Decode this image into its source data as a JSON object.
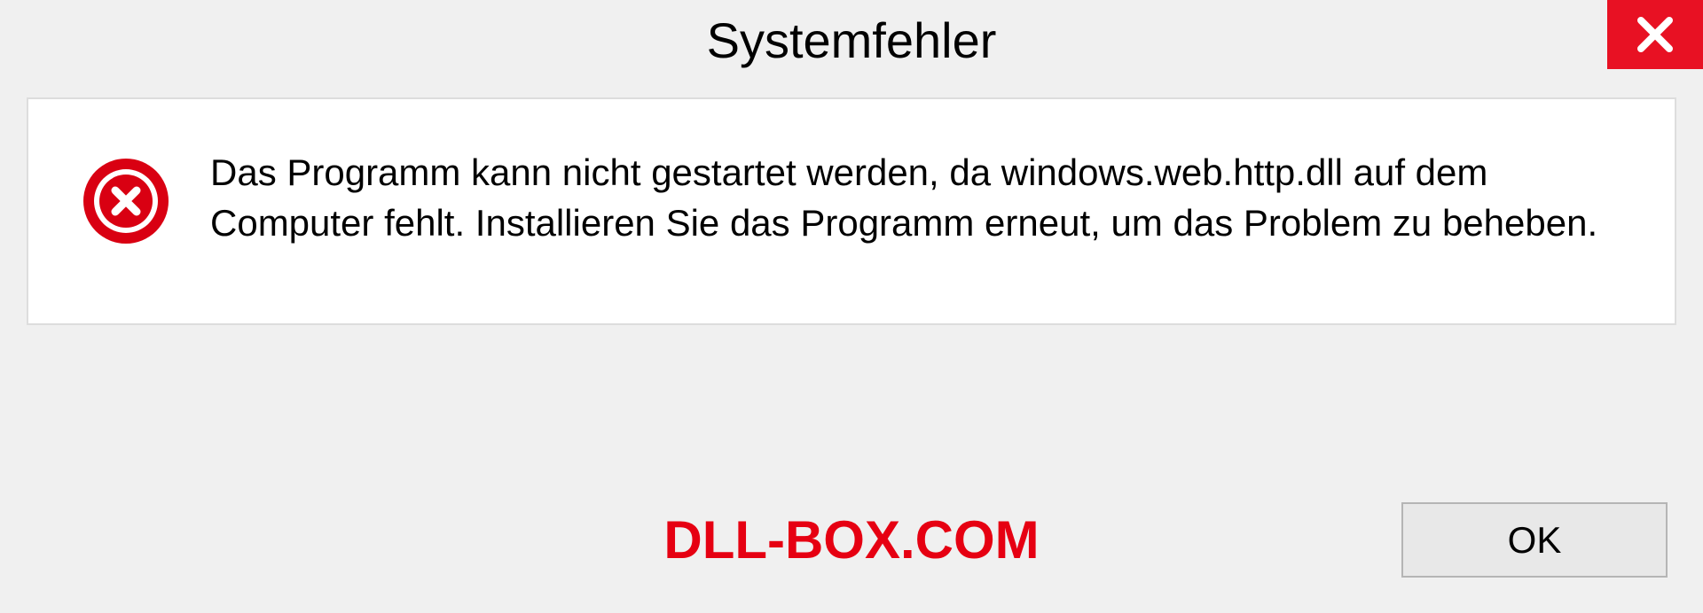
{
  "dialog": {
    "title": "Systemfehler",
    "message": "Das Programm kann nicht gestartet werden, da windows.web.http.dll auf dem Computer fehlt. Installieren Sie das Programm erneut, um das Problem zu beheben.",
    "ok_label": "OK"
  },
  "watermark": "DLL-BOX.COM"
}
